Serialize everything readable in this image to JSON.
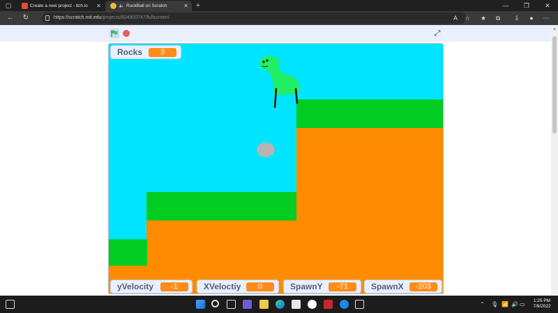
{
  "browser": {
    "tabs": [
      {
        "label": "Create a new project - itch.io"
      },
      {
        "label": "RockBall on Scratch"
      }
    ],
    "address": {
      "host": "https://scratch.mit.edu",
      "path": "/projects/604900747/fullscreen/"
    }
  },
  "stage": {
    "colors": {
      "sky": "#00e5ff",
      "grass": "#00cc22",
      "dirt": "#ff8c00",
      "monitor_value": "#ff8c1a",
      "dino": "#22ee66",
      "rock": "#b4b4b4"
    },
    "monitors": {
      "rocks": {
        "label": "Rocks",
        "value": "3"
      },
      "yvelocity": {
        "label": "yVelocity",
        "value": "-1"
      },
      "xvelocity": {
        "label": "XVeloctiy",
        "value": "0"
      },
      "spawny": {
        "label": "SpawnY",
        "value": "-71"
      },
      "spawnx": {
        "label": "SpawnX",
        "value": "-203"
      }
    }
  },
  "taskbar": {
    "clock_time": "1:25 PM",
    "clock_date": "7/9/2022"
  },
  "icons": [
    "green-flag-icon",
    "stop-icon",
    "fullscreen-icon",
    "windows-start-icon",
    "search-icon",
    "edge-browser-icon",
    "wifi-icon",
    "volume-icon"
  ]
}
